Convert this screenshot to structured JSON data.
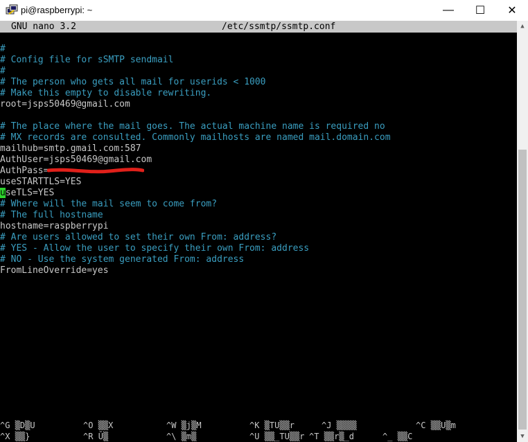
{
  "window": {
    "title": "pi@raspberrypi: ~",
    "controls": {
      "minimize": "—",
      "maximize": "☐",
      "close": "✕"
    }
  },
  "nano": {
    "version": "GNU nano 3.2",
    "filename": "/etc/ssmtp/ssmtp.conf"
  },
  "file_lines": [
    "",
    "#",
    "# Config file for sSMTP sendmail",
    "#",
    "# The person who gets all mail for userids < 1000",
    "# Make this empty to disable rewriting.",
    "root=jsps50469@gmail.com",
    "",
    "# The place where the mail goes. The actual machine name is required no",
    "# MX records are consulted. Commonly mailhosts are named mail.domain.com",
    "mailhub=smtp.gmail.com:587",
    "AuthUser=jsps50469@gmail.com",
    "AuthPass=",
    "useSTARTTLS=YES",
    "useTLS=YES",
    "# Where will the mail seem to come from?",
    "# The full hostname",
    "hostname=raspberrypi",
    "# Are users allowed to set their own From: address?",
    "# YES - Allow the user to specify their own From: address",
    "# NO - Use the system generated From: address",
    "FromLineOverride=yes"
  ],
  "cursor": {
    "line": 14,
    "char": "u",
    "rest": "seTLS=YES"
  },
  "shortcuts_row1": [
    {
      "key": "^G",
      "label": "▒D▒U"
    },
    {
      "key": "^O",
      "label": "▒▒X"
    },
    {
      "key": "^W",
      "label": "▒j▒M"
    },
    {
      "key": "^K",
      "label": "▒TU▒▒r"
    },
    {
      "key": "^J",
      "label": "▒▒▒▒"
    },
    {
      "key": "^C",
      "label": "▒▒U▒m"
    }
  ],
  "shortcuts_row2": [
    {
      "key": "^X",
      "label": "▒▒}"
    },
    {
      "key": "^R",
      "label": "Ū▒"
    },
    {
      "key": "^\\",
      "label": "▒m▒"
    },
    {
      "key": "^U",
      "label": "▒▒_TU▒▒r"
    },
    {
      "key": "^T",
      "label": "▒▒r▒_d"
    },
    {
      "key": "^_",
      "label": "▒▒C"
    }
  ],
  "colors": {
    "comment": "#3a9ec0",
    "text": "#c8c8c8",
    "cursor": "#2ed52e",
    "redaction": "#e0201a"
  }
}
